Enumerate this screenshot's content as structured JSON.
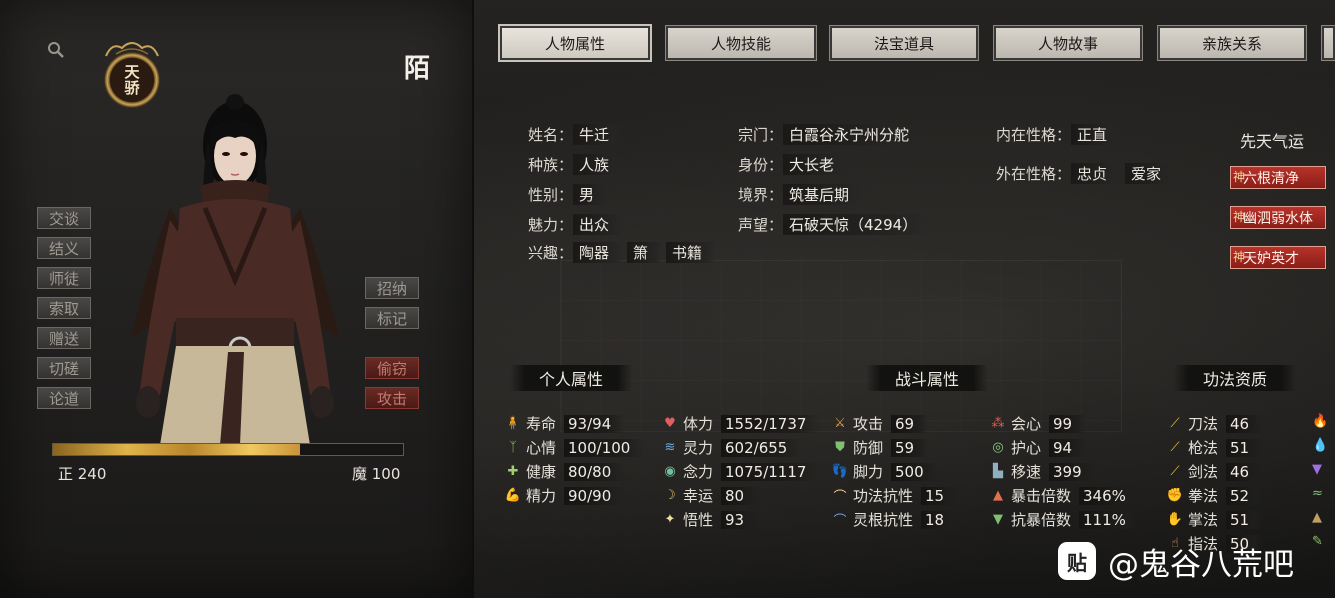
{
  "character": {
    "name": "陌",
    "emblem": "天骄",
    "righteous": "正 240",
    "demonic": "魔 100",
    "alignment_fill": 0.705
  },
  "side_buttons": [
    "交谈",
    "结义",
    "师徒",
    "索取",
    "赠送",
    "切磋",
    "论道"
  ],
  "action_buttons": [
    "招纳",
    "标记"
  ],
  "danger_buttons": [
    "偷窃",
    "攻击"
  ],
  "tabs": [
    "人物属性",
    "人物技能",
    "法宝道具",
    "人物故事",
    "亲族关系"
  ],
  "info": {
    "col1": [
      {
        "k": "姓名：",
        "v": "牛迁"
      },
      {
        "k": "种族：",
        "v": "人族"
      },
      {
        "k": "性别：",
        "v": "男"
      },
      {
        "k": "魅力：",
        "v": "出众"
      }
    ],
    "hobby_label": "兴趣：",
    "hobbies": [
      "陶器",
      "箫",
      "书籍"
    ],
    "col2": [
      {
        "k": "宗门：",
        "v": "白霞谷永宁州分舵"
      },
      {
        "k": "身份：",
        "v": "大长老"
      },
      {
        "k": "境界：",
        "v": "筑基后期"
      },
      {
        "k": "声望：",
        "v": "石破天惊（4294）"
      }
    ],
    "inner_label": "内在性格：",
    "inner": [
      "正直"
    ],
    "outer_label": "外在性格：",
    "outer": [
      "忠贞",
      "爱家"
    ]
  },
  "fate": {
    "title": "先天气运",
    "items": [
      "六根清净",
      "幽泗弱水体",
      "天妒英才"
    ],
    "mark": "神"
  },
  "sections": {
    "personal": "个人属性",
    "combat": "战斗属性",
    "aptitude": "功法资质"
  },
  "personal_stats": [
    {
      "icon": "person-icon",
      "sym": "🧍",
      "color": "#d8a050",
      "k": "寿命",
      "v": "93/94"
    },
    {
      "icon": "sprout-icon",
      "sym": "ᛉ",
      "color": "#8ac060",
      "k": "心情",
      "v": "100/100"
    },
    {
      "icon": "cross-icon",
      "sym": "✚",
      "color": "#a0d070",
      "k": "健康",
      "v": "80/80"
    },
    {
      "icon": "arm-icon",
      "sym": "💪",
      "color": "#d89060",
      "k": "精力",
      "v": "90/90"
    }
  ],
  "body_stats": [
    {
      "icon": "heart-icon",
      "sym": "♥",
      "color": "#e06060",
      "k": "体力",
      "v": "1552/1737"
    },
    {
      "icon": "wave-icon",
      "sym": "≋",
      "color": "#70a8e0",
      "k": "灵力",
      "v": "602/655"
    },
    {
      "icon": "eye-icon",
      "sym": "◉",
      "color": "#70c0a0",
      "k": "念力",
      "v": "1075/1117"
    },
    {
      "icon": "moon-icon",
      "sym": "☽",
      "color": "#e0c060",
      "k": "幸运",
      "v": "80"
    },
    {
      "icon": "star-icon",
      "sym": "✦",
      "color": "#f0e0a0",
      "k": "悟性",
      "v": "93"
    }
  ],
  "combat_stats": [
    {
      "icon": "swords-icon",
      "sym": "⚔",
      "color": "#e0a040",
      "k": "攻击",
      "v": "69"
    },
    {
      "icon": "shield-icon",
      "sym": "⛊",
      "color": "#80c070",
      "k": "防御",
      "v": "59"
    },
    {
      "icon": "feet-icon",
      "sym": "👣",
      "color": "#e0a070",
      "k": "脚力",
      "v": "500"
    },
    {
      "icon": "dome-icon",
      "sym": "⌒",
      "color": "#f0d080",
      "k": "功法抗性",
      "v": "15"
    },
    {
      "icon": "dome-blue-icon",
      "sym": "⌒",
      "color": "#80a0e0",
      "k": "灵根抗性",
      "v": "18"
    }
  ],
  "crit_stats": [
    {
      "icon": "crit-icon",
      "sym": "⁂",
      "color": "#e06050",
      "k": "会心",
      "v": "99"
    },
    {
      "icon": "guard-icon",
      "sym": "◎",
      "color": "#80d080",
      "k": "护心",
      "v": "94"
    },
    {
      "icon": "boot-icon",
      "sym": "▙",
      "color": "#90b0c0",
      "k": "移速",
      "v": "399"
    },
    {
      "icon": "crit-mult-icon",
      "sym": "▲",
      "color": "#e07050",
      "k": "暴击倍数",
      "v": "346%"
    },
    {
      "icon": "anti-crit-icon",
      "sym": "▼",
      "color": "#80c070",
      "k": "抗暴倍数",
      "v": "111%"
    }
  ],
  "aptitude_stats": [
    {
      "icon": "blade-icon",
      "sym": "⟋",
      "color": "#e0c040",
      "k": "刀法",
      "v": "46"
    },
    {
      "icon": "spear-icon",
      "sym": "⟋",
      "color": "#e0c040",
      "k": "枪法",
      "v": "51"
    },
    {
      "icon": "sword-icon",
      "sym": "⟋",
      "color": "#e0c040",
      "k": "剑法",
      "v": "46"
    },
    {
      "icon": "fist-icon",
      "sym": "✊",
      "color": "#e08060",
      "k": "拳法",
      "v": "52"
    },
    {
      "icon": "palm-icon",
      "sym": "✋",
      "color": "#e07060",
      "k": "掌法",
      "v": "51"
    },
    {
      "icon": "finger-icon",
      "sym": "☝",
      "color": "#e0a060",
      "k": "指法",
      "v": "50"
    }
  ],
  "watermark": {
    "icon": "贴",
    "text": "@鬼谷八荒吧"
  }
}
